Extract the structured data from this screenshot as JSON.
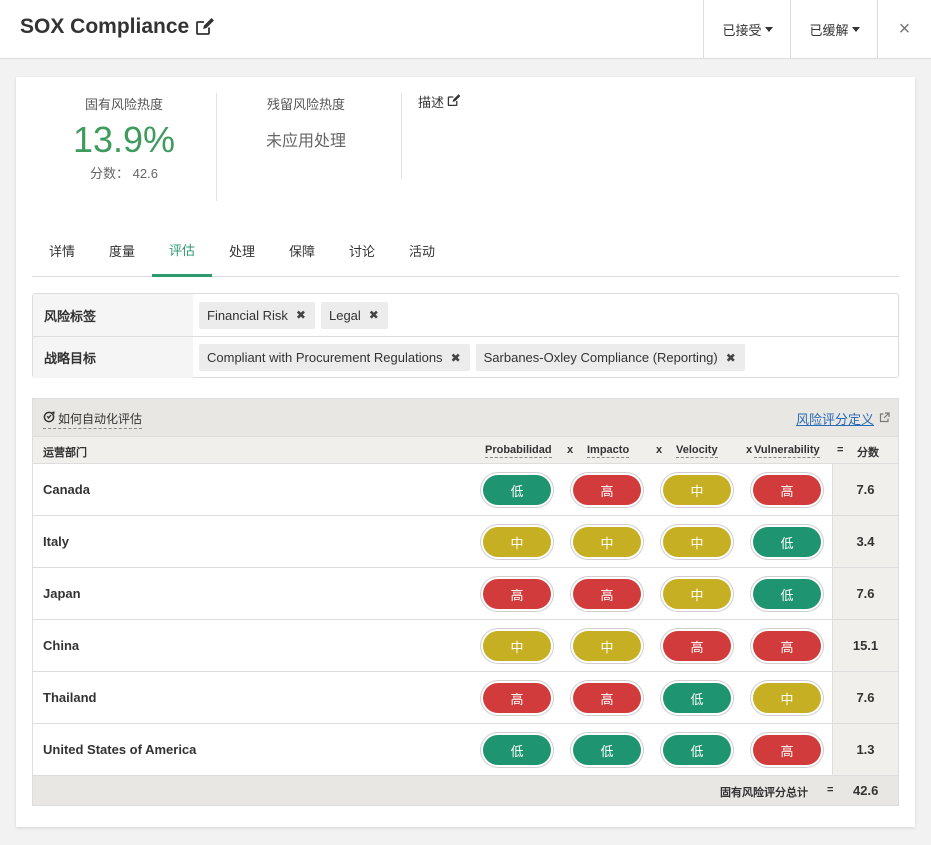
{
  "header": {
    "title": "SOX Compliance",
    "accepted_label": "已接受",
    "mitigated_label": "已缓解",
    "close_label": "×"
  },
  "metrics": {
    "inherent_label": "固有风险热度",
    "inherent_value": "13.9%",
    "inherent_score": "分数： 42.6",
    "residual_label": "残留风险热度",
    "residual_value": "未应用处理",
    "description_label": "描述"
  },
  "tabs": [
    {
      "label": "详情"
    },
    {
      "label": "度量"
    },
    {
      "label": "评估",
      "active": true
    },
    {
      "label": "处理"
    },
    {
      "label": "保障"
    },
    {
      "label": "讨论"
    },
    {
      "label": "活动"
    }
  ],
  "tags": {
    "risk_tags_label": "风险标签",
    "risk_tags": [
      "Financial Risk",
      "Legal"
    ],
    "objectives_label": "战略目标",
    "objectives": [
      "Compliant with Procurement Regulations",
      "Sarbanes-Oxley Compliance (Reporting)"
    ]
  },
  "assessment": {
    "auto_label": "如何自动化评估",
    "definitions_label": "风险评分定义",
    "col_department": "运营部门",
    "col_probability": "Probabilidad",
    "col_impact": "Impacto",
    "col_velocity": "Velocity",
    "col_vulnerability": "Vulnerability",
    "op_times": "x",
    "op_equals": "=",
    "col_score": "分数",
    "rows": [
      {
        "name": "Canada",
        "p": "低",
        "i": "高",
        "v": "中",
        "vu": "高",
        "score": "7.6"
      },
      {
        "name": "Italy",
        "p": "中",
        "i": "中",
        "v": "中",
        "vu": "低",
        "score": "3.4"
      },
      {
        "name": "Japan",
        "p": "高",
        "i": "高",
        "v": "中",
        "vu": "低",
        "score": "7.6"
      },
      {
        "name": "China",
        "p": "中",
        "i": "中",
        "v": "高",
        "vu": "高",
        "score": "15.1"
      },
      {
        "name": "Thailand",
        "p": "高",
        "i": "高",
        "v": "低",
        "vu": "中",
        "score": "7.6"
      },
      {
        "name": "United States of America",
        "p": "低",
        "i": "低",
        "v": "低",
        "vu": "高",
        "score": "1.3"
      }
    ],
    "total_label": "固有风险评分总计",
    "total_equals": "=",
    "total_value": "42.6"
  },
  "colors": {
    "low": "#1f9470",
    "medium": "#c7af23",
    "high": "#d23b3b",
    "accent": "#2e9b6e",
    "inherent_value": "#3e9b5d"
  }
}
